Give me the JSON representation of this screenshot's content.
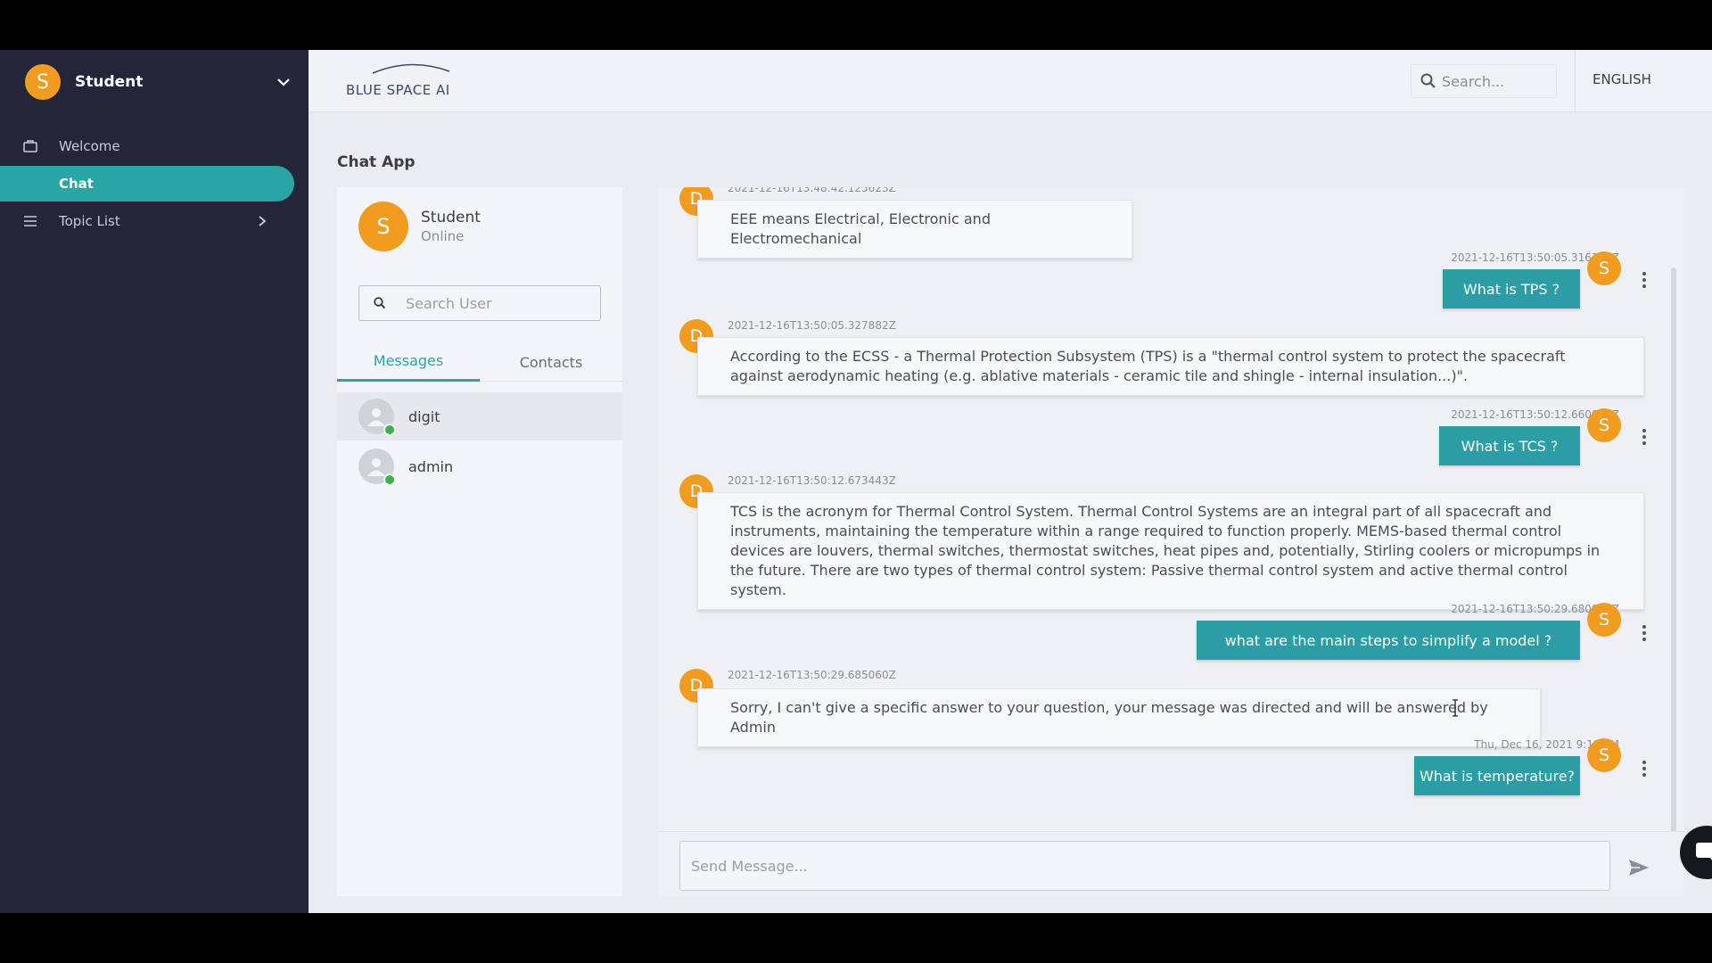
{
  "sidebar": {
    "user_initial": "S",
    "user_name": "Student",
    "items": [
      {
        "label": "Welcome"
      },
      {
        "label": "Chat"
      },
      {
        "label": "Topic List"
      }
    ]
  },
  "header": {
    "logo_text": "BLUE SPACE AI",
    "search_placeholder": "Search...",
    "language": "ENGLISH"
  },
  "page_title": "Chat App",
  "profile": {
    "initial": "S",
    "name": "Student",
    "status": "Online"
  },
  "search_user_placeholder": "Search User",
  "tabs": [
    {
      "label": "Messages"
    },
    {
      "label": "Contacts"
    }
  ],
  "contacts": [
    {
      "name": "digit"
    },
    {
      "name": "admin"
    }
  ],
  "messages": [
    {
      "sender": "D",
      "timestamp": "2021-12-16T13:48:42.125623Z",
      "text": "EEE means Electrical, Electronic and Electromechanical"
    },
    {
      "sender": "S",
      "timestamp": "2021-12-16T13:50:05.316322Z",
      "text": "What is TPS ?"
    },
    {
      "sender": "D",
      "timestamp": "2021-12-16T13:50:05.327882Z",
      "text": "According to the ECSS - a Thermal Protection Subsystem (TPS) is a \"thermal control system to protect the spacecraft against aerodynamic heating (e.g. ablative materials - ceramic tile and shingle - internal insulation...)\"."
    },
    {
      "sender": "S",
      "timestamp": "2021-12-16T13:50:12.660050Z",
      "text": "What is TCS ?"
    },
    {
      "sender": "D",
      "timestamp": "2021-12-16T13:50:12.673443Z",
      "text": "TCS is the acronym for Thermal Control System. Thermal Control Systems are an integral part of all spacecraft and instruments, maintaining the temperature within a range required to function properly. MEMS-based thermal control devices are louvers, thermal switches, thermostat switches, heat pipes and, potentially, Stirling coolers or micropumps in the future. There are two types of thermal control system: Passive thermal control system and active thermal control system."
    },
    {
      "sender": "S",
      "timestamp": "2021-12-16T13:50:29.680053Z",
      "text": "what are the main steps to simplify a model ?"
    },
    {
      "sender": "D",
      "timestamp": "2021-12-16T13:50:29.685060Z",
      "text": "Sorry, I can't give a specific answer to your question, your message was directed and will be answered by Admin"
    },
    {
      "sender": "S",
      "timestamp": "Thu, Dec 16, 2021 9:18 PM",
      "text": "What is temperature?"
    }
  ],
  "compose_placeholder": "Send Message...",
  "colors": {
    "sidebar_bg": "#232639",
    "accent_teal": "#2aa5a5",
    "avatar_orange": "#f29c1f",
    "online_green": "#3bb24b"
  },
  "icons": [
    "briefcase-icon",
    "menu-icon",
    "chevron-down-icon",
    "chevron-right-icon",
    "search-icon",
    "user-placeholder-icon",
    "kebab-icon",
    "send-icon",
    "chat-icon"
  ]
}
